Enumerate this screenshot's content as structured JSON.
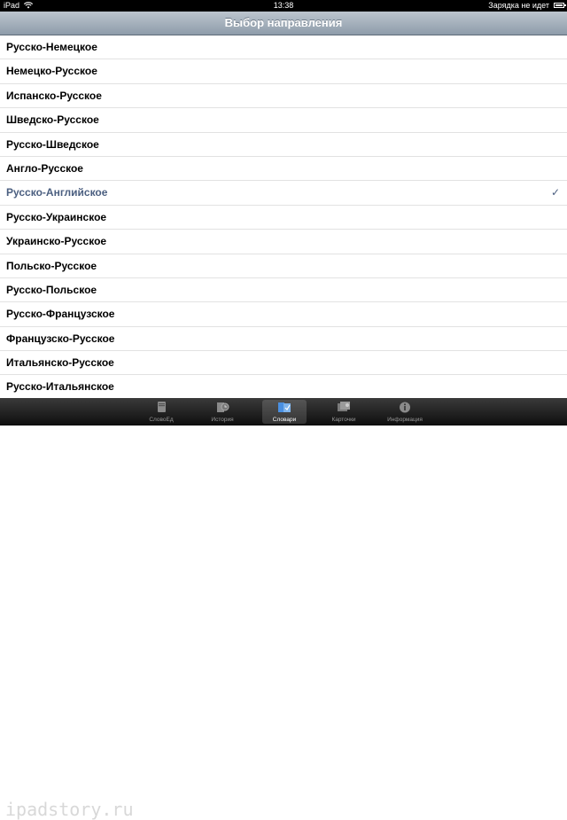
{
  "status_bar": {
    "device": "iPad",
    "time": "13:38",
    "battery_text": "Зарядка не идет"
  },
  "nav_bar": {
    "title": "Выбор направления"
  },
  "list": {
    "items": [
      {
        "label": "Русско-Немецкое"
      },
      {
        "label": "Немецко-Русское"
      },
      {
        "label": "Испанско-Русское"
      },
      {
        "label": "Шведско-Русское"
      },
      {
        "label": "Русско-Шведское"
      },
      {
        "label": "Англо-Русское"
      },
      {
        "label": "Русско-Английское",
        "selected": true,
        "check": "✓"
      },
      {
        "label": "Русско-Украинское"
      },
      {
        "label": "Украинско-Русское"
      },
      {
        "label": "Польско-Русское"
      },
      {
        "label": "Русско-Польское"
      },
      {
        "label": "Русско-Французское"
      },
      {
        "label": "Французско-Русское"
      },
      {
        "label": "Итальянско-Русское"
      },
      {
        "label": "Русско-Итальянское"
      }
    ]
  },
  "tab_bar": {
    "tabs": [
      {
        "label": "СловоЕд",
        "icon": "book-icon"
      },
      {
        "label": "История",
        "icon": "history-icon"
      },
      {
        "label": "Словари",
        "icon": "dictionaries-icon",
        "active": true
      },
      {
        "label": "Карточки",
        "icon": "flashcards-icon"
      },
      {
        "label": "Информация",
        "icon": "info-icon"
      }
    ]
  },
  "watermark": "ipadstory.ru",
  "colors": {
    "selected_text": "#4b5f80",
    "nav_bar_top": "#bcc5ce",
    "nav_bar_bottom": "#8e9caa"
  }
}
